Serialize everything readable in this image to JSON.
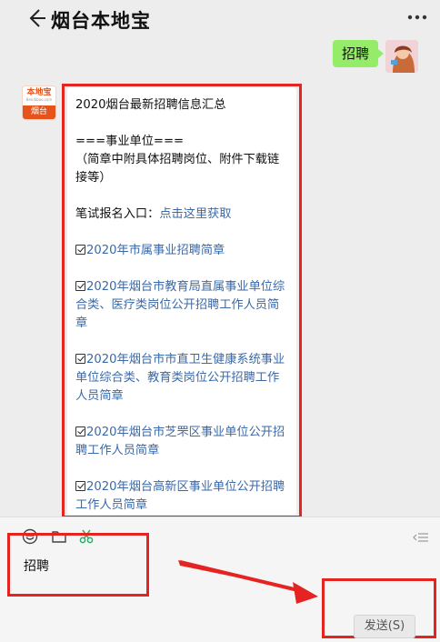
{
  "header": {
    "title": "烟台本地宝",
    "back_icon": "back-arrow-icon",
    "more_icon": "more-dots-icon"
  },
  "sent_message": {
    "text": "招聘"
  },
  "bot": {
    "avatar_top_text": "本地宝",
    "avatar_sub_text": "Bendibao.com",
    "avatar_bottom_text": "烟台"
  },
  "reply": {
    "title": "2020烟台最新招聘信息汇总",
    "section_heading": "===事业单位===",
    "note": "（简章中附具体招聘岗位、附件下载链接等）",
    "exam_label": "笔试报名入口：",
    "exam_link": "点击这里获取",
    "links": [
      "2020年市属事业招聘简章",
      "2020年烟台市教育局直属事业单位综合类、医疗类岗位公开招聘工作人员简章",
      "2020年烟台市市直卫生健康系统事业单位综合类、教育类岗位公开招聘工作人员简章",
      "2020年烟台市芝罘区事业单位公开招聘工作人员简章",
      "2020年烟台高新区事业单位公开招聘工作人员简章"
    ]
  },
  "input": {
    "text": "招聘",
    "send_label": "发送(S)"
  },
  "colors": {
    "highlight_red": "#e52421",
    "sent_green": "#95ec69",
    "link_blue": "#3b6aa8",
    "brand_orange": "#e6541c"
  }
}
